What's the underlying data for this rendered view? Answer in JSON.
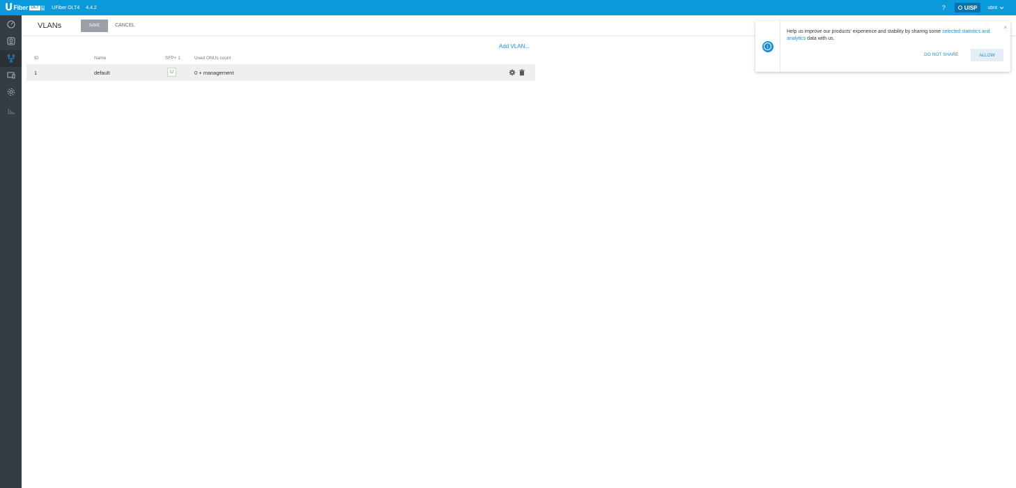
{
  "app": {
    "logo_u": "U",
    "logo_text": "Fiber",
    "logo_badge": "OLT",
    "logo_badge2": "4",
    "device_name": "UFiber OLT4",
    "version": "4.4.2",
    "help": "?",
    "uisp_label": "UISP",
    "user": "ubnt"
  },
  "sidebar": {
    "items": [
      {
        "icon": "dashboard-icon"
      },
      {
        "icon": "onu-device-icon"
      },
      {
        "icon": "vlan-network-icon",
        "active": true
      },
      {
        "icon": "devices-icon"
      },
      {
        "icon": "settings-icon"
      },
      {
        "icon": "statistics-icon"
      }
    ]
  },
  "header": {
    "title": "VLANs",
    "save_label": "SAVE",
    "cancel_label": "CANCEL"
  },
  "content": {
    "add_vlan": "Add VLAN...",
    "columns": [
      "ID",
      "Name",
      "SFP+ 1",
      "Used ONUs count"
    ],
    "rows": [
      {
        "id": "1",
        "name": "default",
        "sfp": "U",
        "onus": "0 + management"
      }
    ]
  },
  "notification": {
    "text_before": "Help us improve our products' experience and stability by sharing some ",
    "link": "selected statistics and analytics",
    "text_after": " data with us.",
    "close": "×",
    "dont_share": "DO NOT SHARE",
    "allow": "ALLOW"
  },
  "colors": {
    "topbar": "#0a9ad9",
    "sidebar": "#363c43",
    "accent": "#1b8fd8"
  }
}
